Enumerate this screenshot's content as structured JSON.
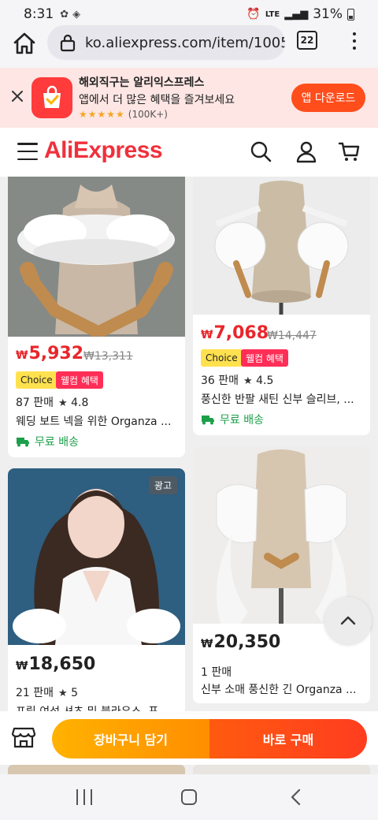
{
  "status_bar": {
    "time": "8:31",
    "battery": "31%",
    "network": "LTE",
    "icons": [
      "alarm-icon",
      "volte-icon",
      "lte-icon",
      "signal-icon",
      "battery-icon"
    ]
  },
  "browser": {
    "url": "ko.aliexpress.com/item/1005",
    "tab_count": "22"
  },
  "app_banner": {
    "line1": "해외직구는 알리익스프레스",
    "line2": "앱에서 더 많은 혜택을 즐겨보세요",
    "stars": "★★★★★",
    "rating_count": "(100K+)",
    "download_label": "앱 다운로드"
  },
  "header": {
    "logo": "AliExpress"
  },
  "products": [
    {
      "currency": "₩",
      "price": "5,932",
      "old_price": "₩13,311",
      "badge_choice": "Choice",
      "badge_welcome": "웰컴 혜택",
      "sold": "87 판매",
      "rating": "4.8",
      "title": "웨딩 보트 넥을 위한 Organza ...",
      "shipping": "무료 배송"
    },
    {
      "currency": "₩",
      "price": "7,068",
      "old_price": "₩14,447",
      "badge_choice": "Choice",
      "badge_welcome": "웰컴 혜택",
      "sold": "36 판매",
      "rating": "4.5",
      "title": "풍신한 반팔 새틴 신부 슬리브, ...",
      "shipping": "무료 배송"
    },
    {
      "ad_label": "광고",
      "currency": "₩",
      "price": "18,650",
      "sold": "21 판매",
      "rating": "5",
      "title": "프릴 여성 셔츠 및 블라우스, 표"
    },
    {
      "currency": "₩",
      "price": "20,350",
      "sold": "1 판매",
      "title": "신부 소매 풍신한 긴 Organza ..."
    }
  ],
  "action_bar": {
    "cart_label": "장바구니 담기",
    "buy_label": "바로 구매"
  },
  "colors": {
    "brand_red": "#f0303c",
    "price_red": "#e8262b",
    "cart_orange": "#ffa000",
    "buy_orange": "#ff4a18",
    "shipping_green": "#1c9f4a",
    "choice_yellow": "#ffe14f",
    "welcome_pink": "#ff2e57"
  }
}
